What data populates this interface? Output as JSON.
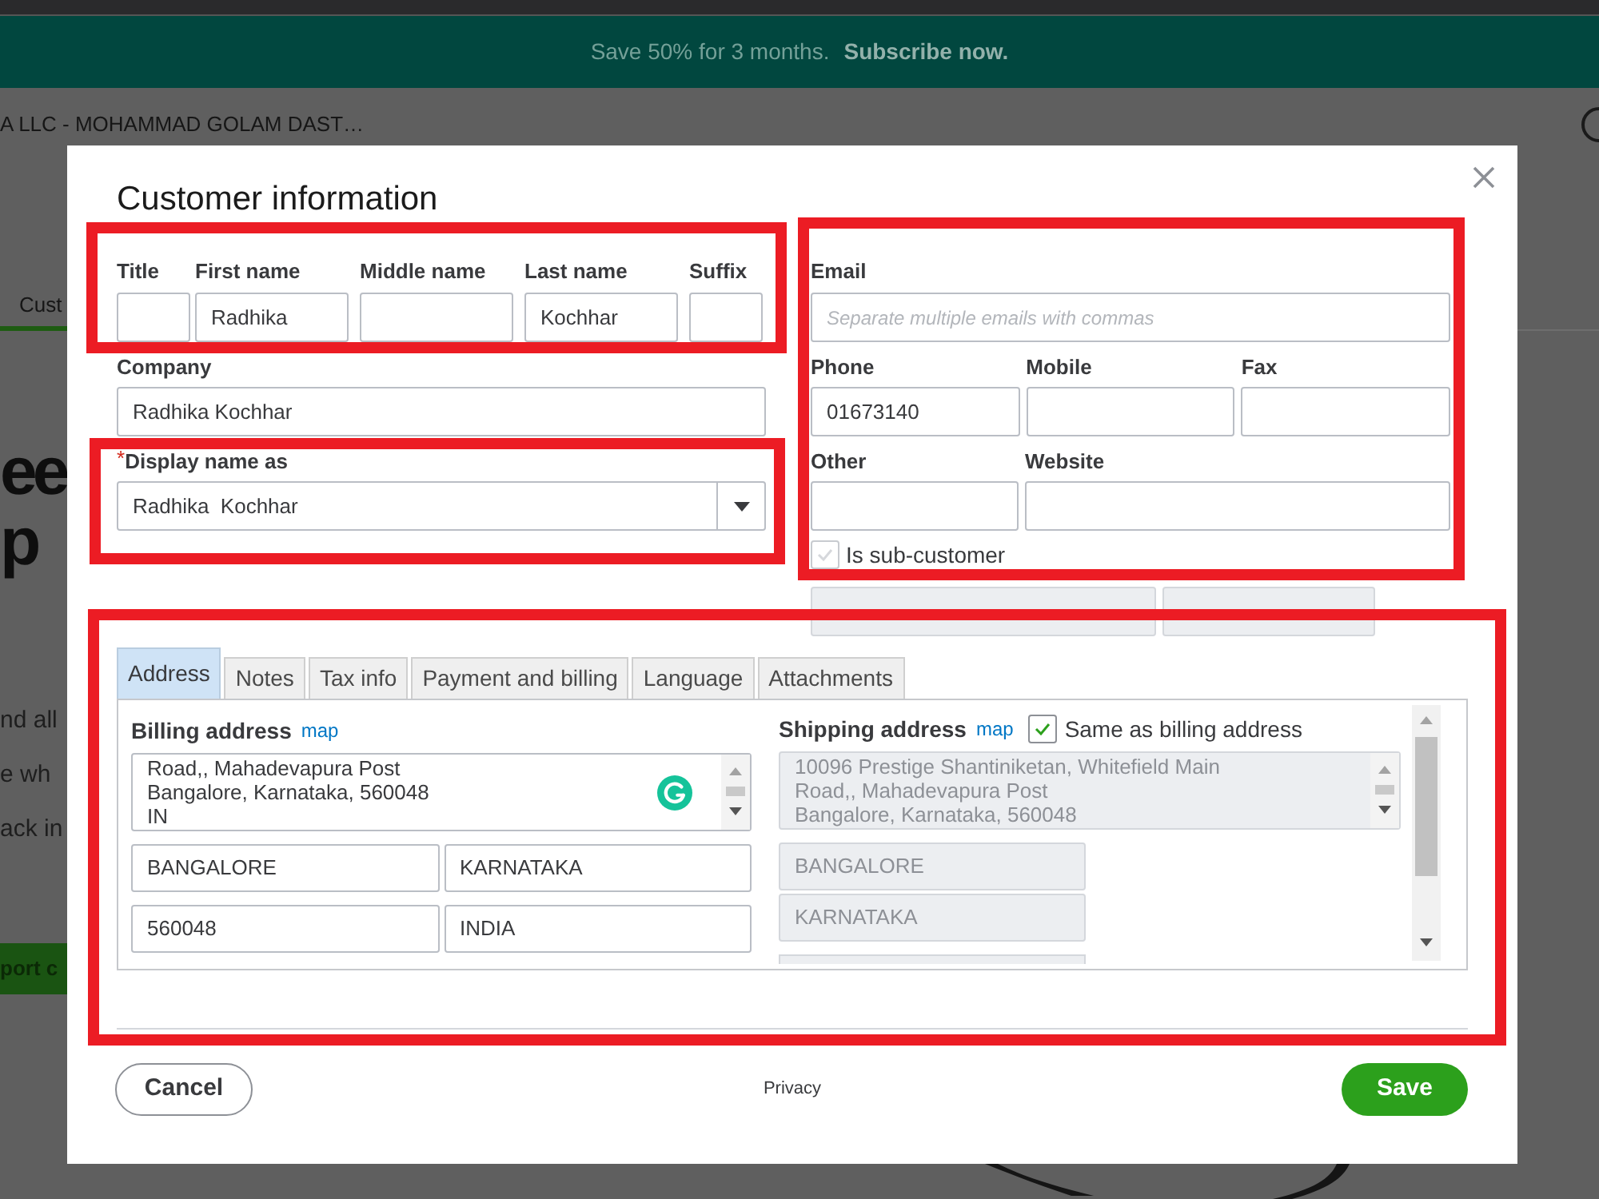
{
  "promo_banner": {
    "text": "Save 50% for 3 months.",
    "link": "Subscribe now."
  },
  "background_page": {
    "company_name": "A LLC - MOHAMMAD GOLAM DAST…",
    "tab": {
      "label": "Cust",
      "selected": true
    },
    "headline": [
      "ee",
      "p"
    ],
    "lines": [
      "nd all",
      "e wh",
      "ack in"
    ],
    "button": "port c"
  },
  "dialog": {
    "title": "Customer information",
    "name_fields": {
      "highlighted": true,
      "fields": [
        {
          "label": "Title"
        },
        {
          "label": "First name",
          "value": "Radhika"
        },
        {
          "label": "Middle name"
        },
        {
          "label": "Last name",
          "value": "Kochhar"
        },
        {
          "label": "Suffix"
        }
      ]
    },
    "company": {
      "label": "Company",
      "value": "Radhika Kochhar"
    },
    "display_name": {
      "highlighted": true,
      "required_mark": "*",
      "label": "Display name as",
      "value": "Radhika  Kochhar"
    },
    "contact": {
      "highlighted": true,
      "email": {
        "label": "Email",
        "placeholder": "Separate multiple emails with commas"
      },
      "phone_row": [
        {
          "label": "Phone",
          "value": "01673140"
        },
        {
          "label": "Mobile"
        },
        {
          "label": "Fax"
        }
      ],
      "other_row": [
        {
          "label": "Other"
        },
        {
          "label": "Website"
        }
      ],
      "sub_customer": {
        "label": "Is sub-customer",
        "checked": false
      }
    },
    "parent_fields": [
      {
        "kind": "text",
        "disabled": true
      },
      {
        "kind": "select",
        "disabled": true
      }
    ],
    "details": {
      "highlighted": true,
      "tabs": [
        {
          "label": "Address",
          "selected": true
        },
        {
          "label": "Notes",
          "selected": false
        },
        {
          "label": "Tax info",
          "selected": false
        },
        {
          "label": "Payment and billing",
          "selected": false
        },
        {
          "label": "Language",
          "selected": false
        },
        {
          "label": "Attachments",
          "selected": false
        }
      ],
      "billing": {
        "title": "Billing address",
        "link": "map",
        "street_lines": [
          "Road,, Mahadevapura Post",
          "Bangalore, Karnataka, 560048",
          "IN"
        ],
        "city": "BANGALORE",
        "state": "KARNATAKA",
        "zip": "560048",
        "country": "INDIA"
      },
      "shipping": {
        "title": "Shipping address",
        "link": "map",
        "same_as_billing": {
          "label": "Same as billing address",
          "checked": true
        },
        "street_lines": [
          "10096 Prestige Shantiniketan, Whitefield Main",
          "Road,, Mahadevapura Post",
          "Bangalore, Karnataka, 560048"
        ],
        "city": "BANGALORE",
        "state": "KARNATAKA"
      }
    },
    "footer": {
      "cancel": "Cancel",
      "privacy": "Privacy",
      "save": "Save"
    }
  }
}
